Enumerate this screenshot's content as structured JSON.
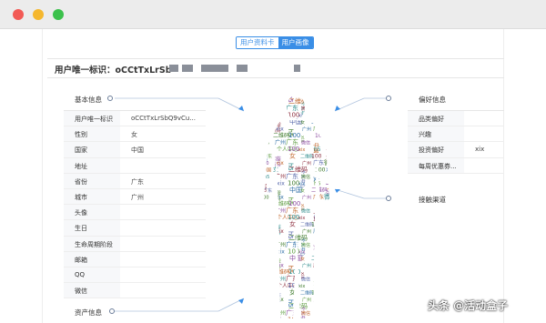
{
  "tabs": [
    {
      "label": "用户资料卡",
      "active": false
    },
    {
      "label": "用户画像",
      "active": true
    }
  ],
  "uid_label": "用户唯一标识：oCCtTxLrSb",
  "sections": {
    "basic": "基本信息",
    "preference": "偏好信息",
    "channel": "接触渠道",
    "asset": "资产信息"
  },
  "basic_rows": [
    {
      "label": "用户唯一标识",
      "value": "oCCtTxLrSbQ9vCu..."
    },
    {
      "label": "性别",
      "value": "女"
    },
    {
      "label": "国家",
      "value": "中国"
    },
    {
      "label": "地址",
      "value": ""
    },
    {
      "label": "省份",
      "value": "广东"
    },
    {
      "label": "城市",
      "value": "广州"
    },
    {
      "label": "头像",
      "value": ""
    },
    {
      "label": "生日",
      "value": ""
    },
    {
      "label": "生命周期阶段",
      "value": ""
    },
    {
      "label": "邮箱",
      "value": ""
    },
    {
      "label": "QQ",
      "value": ""
    },
    {
      "label": "微信",
      "value": ""
    }
  ],
  "pref_rows": [
    {
      "label": "品类偏好",
      "value": ""
    },
    {
      "label": "兴趣",
      "value": ""
    },
    {
      "label": "投资偏好",
      "value": "xix"
    },
    {
      "label": "每周优惠券...",
      "value": ""
    }
  ],
  "word_cloud": [
    "100",
    "xix",
    "h5",
    "广州",
    "广东",
    "微信",
    "中国",
    "女",
    "二维码",
    "个人中心",
    "100",
    "xix",
    "h5",
    "广州",
    "广东",
    "微信",
    "女",
    "二维码",
    "100",
    "xix"
  ],
  "watermark": "头条 @活动盒子",
  "colors": {
    "accent": "#3a8ee6",
    "mask": "#8a8f99"
  }
}
